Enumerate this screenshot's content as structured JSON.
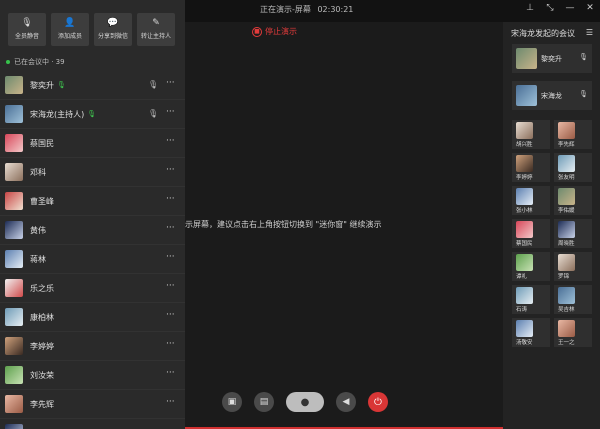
{
  "topbar": {
    "status_label": "正在演示-屏幕",
    "timer": "02:30:21",
    "pin_icon": "pin-icon",
    "shrink_icon": "shrink-icon",
    "minimize_icon": "minimize-icon",
    "close_icon": "close-icon"
  },
  "stop_presenting": {
    "label": "停止演示",
    "icon": "stop-icon",
    "color": "#e23b3b"
  },
  "stage": {
    "notice": "示屏幕，建议点击右上角按钮切换到 \"迷你窗\" 继续演示"
  },
  "actions": [
    {
      "label": "全员静音",
      "icon": "mute-all-icon"
    },
    {
      "label": "添加成员",
      "icon": "add-member-icon"
    },
    {
      "label": "分享到微信",
      "icon": "wechat-share-icon"
    },
    {
      "label": "转让主持人",
      "icon": "transfer-host-icon"
    }
  ],
  "members_header": {
    "label": "已在会议中 · 39"
  },
  "members": [
    {
      "name": "黎奕升",
      "avatar": "av1",
      "speaking": true,
      "muted": true
    },
    {
      "name": "宋海龙(主持人)",
      "avatar": "av2",
      "speaking": true,
      "muted": true
    },
    {
      "name": "蔡国民",
      "avatar": "av3",
      "speaking": false,
      "muted": false
    },
    {
      "name": "邓科",
      "avatar": "av4",
      "speaking": false,
      "muted": false
    },
    {
      "name": "曹圣峰",
      "avatar": "av5",
      "speaking": false,
      "muted": false
    },
    {
      "name": "黄伟",
      "avatar": "av6",
      "speaking": false,
      "muted": false
    },
    {
      "name": "蒋林",
      "avatar": "av7",
      "speaking": false,
      "muted": false
    },
    {
      "name": "乐之乐",
      "avatar": "av8",
      "speaking": false,
      "muted": false
    },
    {
      "name": "康柏林",
      "avatar": "av9",
      "speaking": false,
      "muted": false
    },
    {
      "name": "李婷婷",
      "avatar": "av10",
      "speaking": false,
      "muted": false
    },
    {
      "name": "刘汝荣",
      "avatar": "av11",
      "speaking": false,
      "muted": false
    },
    {
      "name": "李先辉",
      "avatar": "av12",
      "speaking": false,
      "muted": false
    },
    {
      "name": "李佐鹏",
      "avatar": "av6",
      "speaking": false,
      "muted": false
    }
  ],
  "right_panel": {
    "title": "宋海龙发起的会议",
    "featured": [
      {
        "name": "黎奕升",
        "avatar": "av1"
      },
      {
        "name": "宋海龙",
        "avatar": "av2"
      }
    ],
    "tiles": [
      {
        "name": "胡兴胜",
        "avatar": "av4"
      },
      {
        "name": "李先辉",
        "avatar": "av12"
      },
      {
        "name": "李婷婷",
        "avatar": "av10"
      },
      {
        "name": "张友明",
        "avatar": "av9"
      },
      {
        "name": "张小林",
        "avatar": "av7"
      },
      {
        "name": "李佑媛",
        "avatar": "av1"
      },
      {
        "name": "蔡国民",
        "avatar": "av3"
      },
      {
        "name": "周晓胜",
        "avatar": "av6"
      },
      {
        "name": "谭礼",
        "avatar": "av11"
      },
      {
        "name": "罗锦",
        "avatar": "av4"
      },
      {
        "name": "石涛",
        "avatar": "av9"
      },
      {
        "name": "吴吉林",
        "avatar": "av2"
      },
      {
        "name": "汤敬安",
        "avatar": "av7"
      },
      {
        "name": "王一之",
        "avatar": "av12"
      }
    ]
  },
  "toolbar": {
    "screen_icon": "screen-share-icon",
    "folder_icon": "folder-icon",
    "mic_icon": "microphone-icon",
    "speaker_icon": "speaker-icon",
    "end_icon": "end-call-icon"
  }
}
